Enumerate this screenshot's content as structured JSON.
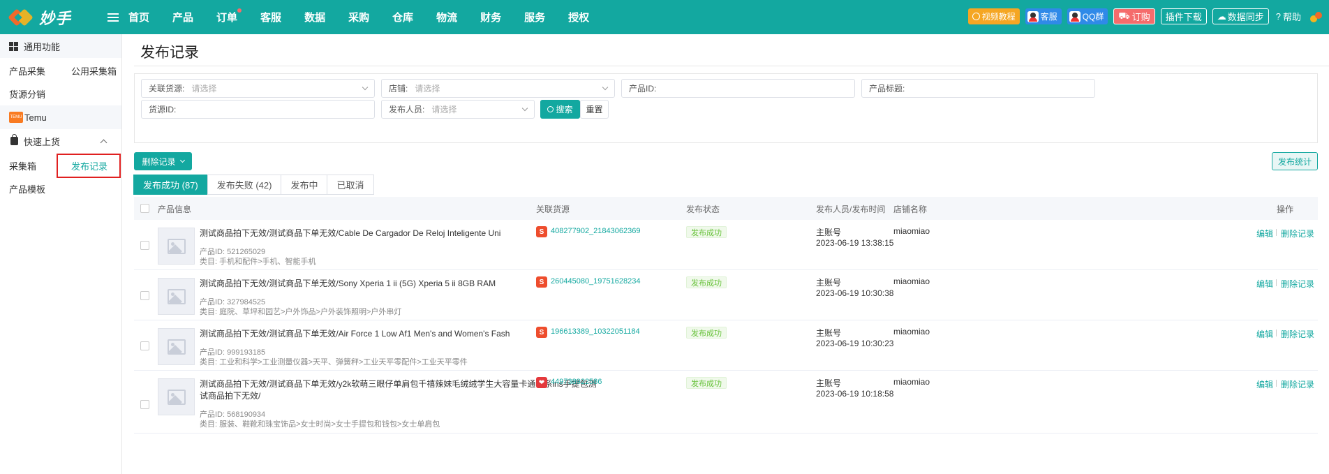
{
  "app": {
    "logo_text": "妙手"
  },
  "nav": {
    "items": [
      "首页",
      "产品",
      "订单",
      "客服",
      "数据",
      "采购",
      "仓库",
      "物流",
      "财务",
      "服务",
      "授权"
    ]
  },
  "topbar": {
    "video": "视频教程",
    "kefu": "客服",
    "qq": "QQ群",
    "order": "订购",
    "plugin": "插件下载",
    "sync": "数据同步",
    "help": "帮助"
  },
  "sidebar": {
    "common": "通用功能",
    "collect": "产品采集",
    "public_box": "公用采集箱",
    "distribution": "货源分销",
    "temu": "Temu",
    "temu_icon": "temu",
    "quick": "快速上货",
    "box": "采集箱",
    "publish_record": "发布记录",
    "template": "产品模板"
  },
  "page": {
    "title": "发布记录"
  },
  "filters": {
    "source_label": "关联货源:",
    "source_ph": "请选择",
    "shop_label": "店铺:",
    "shop_ph": "请选择",
    "product_id_label": "产品ID:",
    "product_title_label": "产品标题:",
    "source_id_label": "货源ID:",
    "publisher_label": "发布人员:",
    "publisher_ph": "请选择",
    "search": "搜索",
    "reset": "重置"
  },
  "actions": {
    "delete": "删除记录",
    "stats": "发布统计"
  },
  "tabs": [
    "发布成功 (87)",
    "发布失败 (42)",
    "发布中",
    "已取消"
  ],
  "table": {
    "headers": {
      "product": "产品信息",
      "source": "关联货源",
      "status": "发布状态",
      "publisher": "发布人员/发布时间",
      "shop": "店铺名称",
      "op": "操作"
    },
    "edit": "编辑",
    "del": "删除记录",
    "rows": [
      {
        "title": "测试商品拍下无效/测试商品下单无效/Cable De Cargador De Reloj Inteligente Uni",
        "pid": "产品ID: 521265029",
        "cat": "类目: 手机和配件>手机、智能手机",
        "src_icon": "S",
        "source": "408277902_21843062369",
        "status": "发布成功",
        "who": "主账号",
        "time": "2023-06-19 13:38:15",
        "shop": "miaomiao"
      },
      {
        "title": "测试商品拍下无效/测试商品下单无效/Sony Xperia 1 ii (5G) Xperia 5 ii  8GB RAM",
        "pid": "产品ID: 327984525",
        "cat": "类目: 庭院、草坪和园艺>户外饰品>户外装饰照明>户外串灯",
        "src_icon": "S",
        "source": "260445080_19751628234",
        "status": "发布成功",
        "who": "主账号",
        "time": "2023-06-19 10:30:38",
        "shop": "miaomiao"
      },
      {
        "title": "测试商品拍下无效/测试商品下单无效/Air Force 1 Low Af1 Men's and Women's Fash",
        "pid": "产品ID: 999193185",
        "cat": "类目: 工业和科学>工业测量仪器>天平、弹簧秤>工业天平零配件>工业天平零件",
        "src_icon": "S",
        "source": "196613389_10322051184",
        "status": "发布成功",
        "who": "主账号",
        "time": "2023-06-19 10:30:23",
        "shop": "miaomiao"
      },
      {
        "title": "测试商品拍下无效/测试商品下单无效/y2k软萌三眼仔单肩包千禧辣妹毛绒绒学生大容量卡通日系ins手提包测",
        "title2": "试商品拍下无效/",
        "pid": "产品ID: 568190934",
        "cat": "类目: 服装、鞋靴和珠宝饰品>女士时尚>女士手提包和钱包>女士单肩包",
        "src_icon": "",
        "source": "449738922586",
        "status": "发布成功",
        "who": "主账号",
        "time": "2023-06-19 10:18:58",
        "shop": "miaomiao"
      }
    ]
  }
}
